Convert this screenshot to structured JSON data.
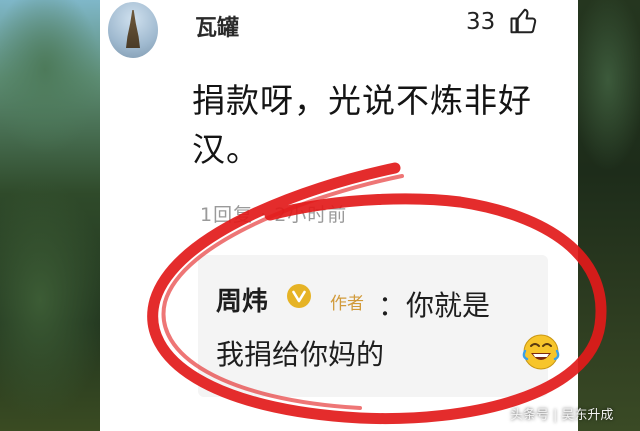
{
  "comment": {
    "username": "瓦罐",
    "like_count": "33",
    "text": "捐款呀，光说不炼非好汉。",
    "meta": "1回复 · 2小时前"
  },
  "reply": {
    "name": "周炜",
    "badge": "作者",
    "line1": "：你就是",
    "line2": "我捐给你妈的"
  },
  "icons": {
    "like": "thumbs-up-icon",
    "verified": "verified-v-icon",
    "emoji": "laughing-emoji-icon"
  },
  "colors": {
    "accent_gold": "#e6b325",
    "badge_text": "#d19a3a",
    "annotation_red": "#e21a1a"
  },
  "watermark": {
    "source": "头条号",
    "author": "吴东升成"
  }
}
